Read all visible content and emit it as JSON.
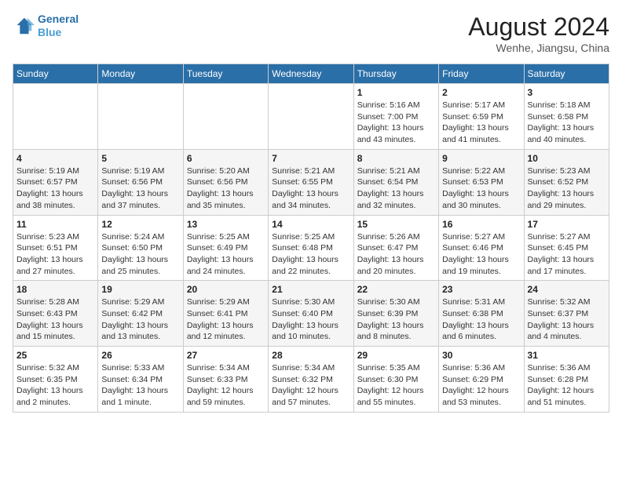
{
  "header": {
    "logo_line1": "General",
    "logo_line2": "Blue",
    "month_year": "August 2024",
    "location": "Wenhe, Jiangsu, China"
  },
  "weekdays": [
    "Sunday",
    "Monday",
    "Tuesday",
    "Wednesday",
    "Thursday",
    "Friday",
    "Saturday"
  ],
  "weeks": [
    [
      {
        "day": "",
        "info": ""
      },
      {
        "day": "",
        "info": ""
      },
      {
        "day": "",
        "info": ""
      },
      {
        "day": "",
        "info": ""
      },
      {
        "day": "1",
        "info": "Sunrise: 5:16 AM\nSunset: 7:00 PM\nDaylight: 13 hours\nand 43 minutes."
      },
      {
        "day": "2",
        "info": "Sunrise: 5:17 AM\nSunset: 6:59 PM\nDaylight: 13 hours\nand 41 minutes."
      },
      {
        "day": "3",
        "info": "Sunrise: 5:18 AM\nSunset: 6:58 PM\nDaylight: 13 hours\nand 40 minutes."
      }
    ],
    [
      {
        "day": "4",
        "info": "Sunrise: 5:19 AM\nSunset: 6:57 PM\nDaylight: 13 hours\nand 38 minutes."
      },
      {
        "day": "5",
        "info": "Sunrise: 5:19 AM\nSunset: 6:56 PM\nDaylight: 13 hours\nand 37 minutes."
      },
      {
        "day": "6",
        "info": "Sunrise: 5:20 AM\nSunset: 6:56 PM\nDaylight: 13 hours\nand 35 minutes."
      },
      {
        "day": "7",
        "info": "Sunrise: 5:21 AM\nSunset: 6:55 PM\nDaylight: 13 hours\nand 34 minutes."
      },
      {
        "day": "8",
        "info": "Sunrise: 5:21 AM\nSunset: 6:54 PM\nDaylight: 13 hours\nand 32 minutes."
      },
      {
        "day": "9",
        "info": "Sunrise: 5:22 AM\nSunset: 6:53 PM\nDaylight: 13 hours\nand 30 minutes."
      },
      {
        "day": "10",
        "info": "Sunrise: 5:23 AM\nSunset: 6:52 PM\nDaylight: 13 hours\nand 29 minutes."
      }
    ],
    [
      {
        "day": "11",
        "info": "Sunrise: 5:23 AM\nSunset: 6:51 PM\nDaylight: 13 hours\nand 27 minutes."
      },
      {
        "day": "12",
        "info": "Sunrise: 5:24 AM\nSunset: 6:50 PM\nDaylight: 13 hours\nand 25 minutes."
      },
      {
        "day": "13",
        "info": "Sunrise: 5:25 AM\nSunset: 6:49 PM\nDaylight: 13 hours\nand 24 minutes."
      },
      {
        "day": "14",
        "info": "Sunrise: 5:25 AM\nSunset: 6:48 PM\nDaylight: 13 hours\nand 22 minutes."
      },
      {
        "day": "15",
        "info": "Sunrise: 5:26 AM\nSunset: 6:47 PM\nDaylight: 13 hours\nand 20 minutes."
      },
      {
        "day": "16",
        "info": "Sunrise: 5:27 AM\nSunset: 6:46 PM\nDaylight: 13 hours\nand 19 minutes."
      },
      {
        "day": "17",
        "info": "Sunrise: 5:27 AM\nSunset: 6:45 PM\nDaylight: 13 hours\nand 17 minutes."
      }
    ],
    [
      {
        "day": "18",
        "info": "Sunrise: 5:28 AM\nSunset: 6:43 PM\nDaylight: 13 hours\nand 15 minutes."
      },
      {
        "day": "19",
        "info": "Sunrise: 5:29 AM\nSunset: 6:42 PM\nDaylight: 13 hours\nand 13 minutes."
      },
      {
        "day": "20",
        "info": "Sunrise: 5:29 AM\nSunset: 6:41 PM\nDaylight: 13 hours\nand 12 minutes."
      },
      {
        "day": "21",
        "info": "Sunrise: 5:30 AM\nSunset: 6:40 PM\nDaylight: 13 hours\nand 10 minutes."
      },
      {
        "day": "22",
        "info": "Sunrise: 5:30 AM\nSunset: 6:39 PM\nDaylight: 13 hours\nand 8 minutes."
      },
      {
        "day": "23",
        "info": "Sunrise: 5:31 AM\nSunset: 6:38 PM\nDaylight: 13 hours\nand 6 minutes."
      },
      {
        "day": "24",
        "info": "Sunrise: 5:32 AM\nSunset: 6:37 PM\nDaylight: 13 hours\nand 4 minutes."
      }
    ],
    [
      {
        "day": "25",
        "info": "Sunrise: 5:32 AM\nSunset: 6:35 PM\nDaylight: 13 hours\nand 2 minutes."
      },
      {
        "day": "26",
        "info": "Sunrise: 5:33 AM\nSunset: 6:34 PM\nDaylight: 13 hours\nand 1 minute."
      },
      {
        "day": "27",
        "info": "Sunrise: 5:34 AM\nSunset: 6:33 PM\nDaylight: 12 hours\nand 59 minutes."
      },
      {
        "day": "28",
        "info": "Sunrise: 5:34 AM\nSunset: 6:32 PM\nDaylight: 12 hours\nand 57 minutes."
      },
      {
        "day": "29",
        "info": "Sunrise: 5:35 AM\nSunset: 6:30 PM\nDaylight: 12 hours\nand 55 minutes."
      },
      {
        "day": "30",
        "info": "Sunrise: 5:36 AM\nSunset: 6:29 PM\nDaylight: 12 hours\nand 53 minutes."
      },
      {
        "day": "31",
        "info": "Sunrise: 5:36 AM\nSunset: 6:28 PM\nDaylight: 12 hours\nand 51 minutes."
      }
    ]
  ]
}
